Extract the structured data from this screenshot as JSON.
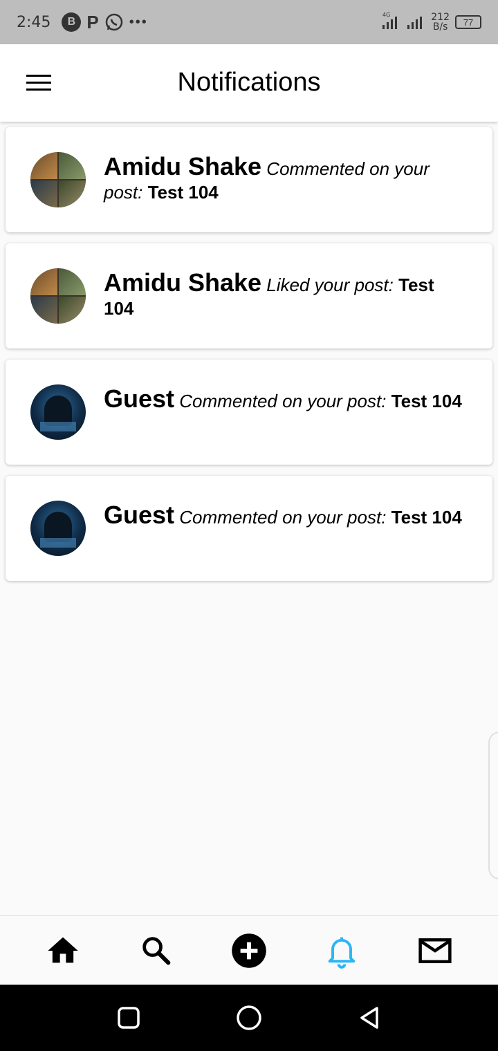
{
  "status_bar": {
    "time": "2:45",
    "icon_b": "B",
    "icon_p": "P",
    "more": "•••",
    "network_type": "4G",
    "speed_value": "212",
    "speed_unit": "B/s",
    "battery": "77"
  },
  "app_bar": {
    "title": "Notifications",
    "menu_icon": "hamburger-menu-icon"
  },
  "notifications": [
    {
      "name": "Amidu Shake",
      "action": "Commented on your post:",
      "post": "Test 104",
      "avatar": "collage"
    },
    {
      "name": "Amidu Shake",
      "action": "Liked your post:",
      "post": "Test 104",
      "avatar": "collage"
    },
    {
      "name": "Guest",
      "action": "Commented on your post:",
      "post": "Test 104",
      "avatar": "hacker"
    },
    {
      "name": "Guest",
      "action": "Commented on your post:",
      "post": "Test 104",
      "avatar": "hacker"
    }
  ],
  "bottom_nav": {
    "items": [
      "home-icon",
      "search-icon",
      "add-icon",
      "bell-icon",
      "mail-icon"
    ],
    "active": "bell-icon",
    "active_color": "#29b6f6",
    "inactive_color": "#000000"
  },
  "system_nav": [
    "recents-icon",
    "home-circle-icon",
    "back-icon"
  ]
}
